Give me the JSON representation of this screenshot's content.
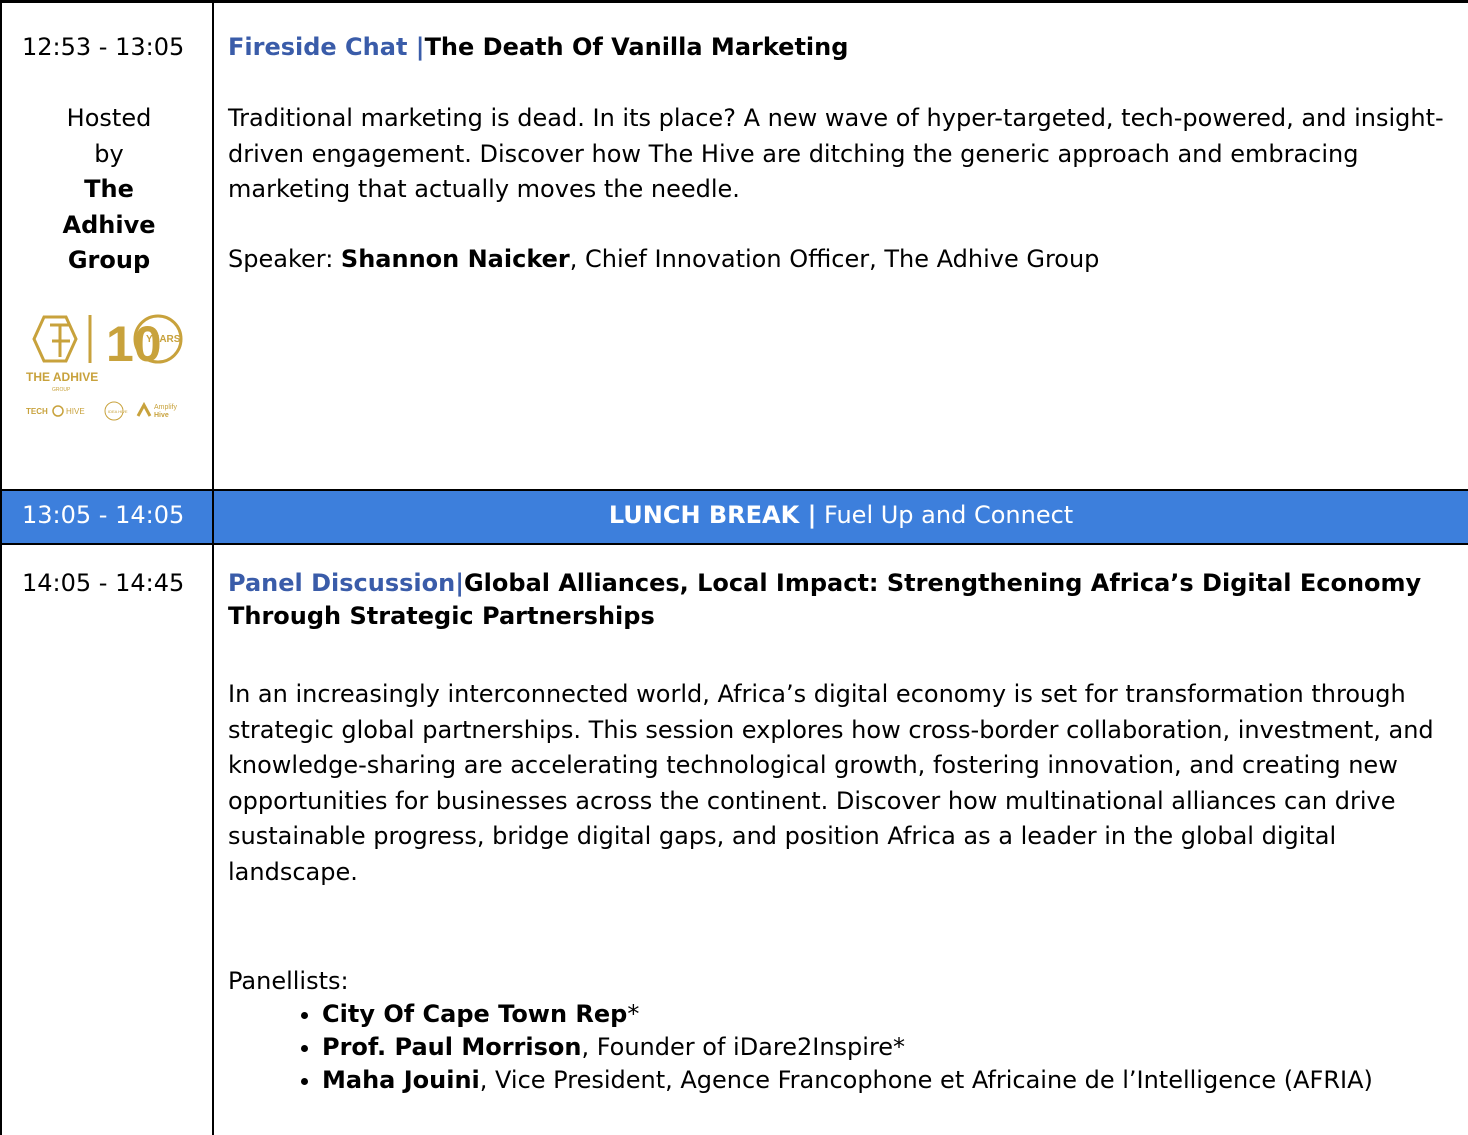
{
  "sessions": [
    {
      "time": "12:53 - 13:05",
      "hosted": [
        "Hosted",
        "by"
      ],
      "host_name": [
        "The",
        "Adhive",
        "Group"
      ],
      "category": "Fireside Chat",
      "separator": " |",
      "title": "The Death Of Vanilla Marketing",
      "description": "Traditional marketing is dead. In its place? A new wave of hyper-targeted, tech-powered, and insight-driven engagement. Discover how The Hive are ditching the generic approach and embracing marketing that actually moves the needle.",
      "speaker_label": "Speaker: ",
      "speaker_name": "Shannon Naicker",
      "speaker_role": ", Chief Innovation Officer, The Adhive Group",
      "logo": {
        "brand": "THE ADHIVE",
        "sub": "GROUP",
        "years_number": "10",
        "years_label": "YEARS",
        "partner1": "TECH",
        "partner1b": "HIVE",
        "partner2": "IDEA HIVE",
        "partner3a": "Amplify",
        "partner3b": "Hive",
        "gold": "#c8a23c"
      }
    },
    {
      "time": "13:05 - 14:05",
      "lunch_bold": "LUNCH BREAK |",
      "lunch_text": " Fuel Up and Connect",
      "bg_color": "#3d7fdc"
    },
    {
      "time": "14:05 - 14:45",
      "category": "Panel Discussion",
      "separator": "|",
      "title": "Global Alliances, Local Impact: Strengthening Africa’s Digital Economy Through Strategic Partnerships",
      "description": "In an increasingly interconnected world, Africa’s digital economy is set for transformation through strategic global partnerships. This session explores how cross-border collaboration, investment, and knowledge-sharing are accelerating technological growth, fostering innovation, and creating new opportunities for businesses across the continent. Discover how multinational alliances can drive sustainable progress, bridge digital gaps, and position Africa as a leader in the global digital landscape.",
      "panellists_label": "Panellists:",
      "panellists": [
        {
          "name": "City Of Cape Town Rep",
          "rest": "*"
        },
        {
          "name": "Prof. Paul Morrison",
          "rest": ", Founder of iDare2Inspire*"
        },
        {
          "name": "Maha Jouini",
          "rest": ", Vice President, Agence Francophone et Africaine de l’Intelligence (AFRIA)"
        }
      ]
    }
  ],
  "accent_color": "#3a5ca9"
}
